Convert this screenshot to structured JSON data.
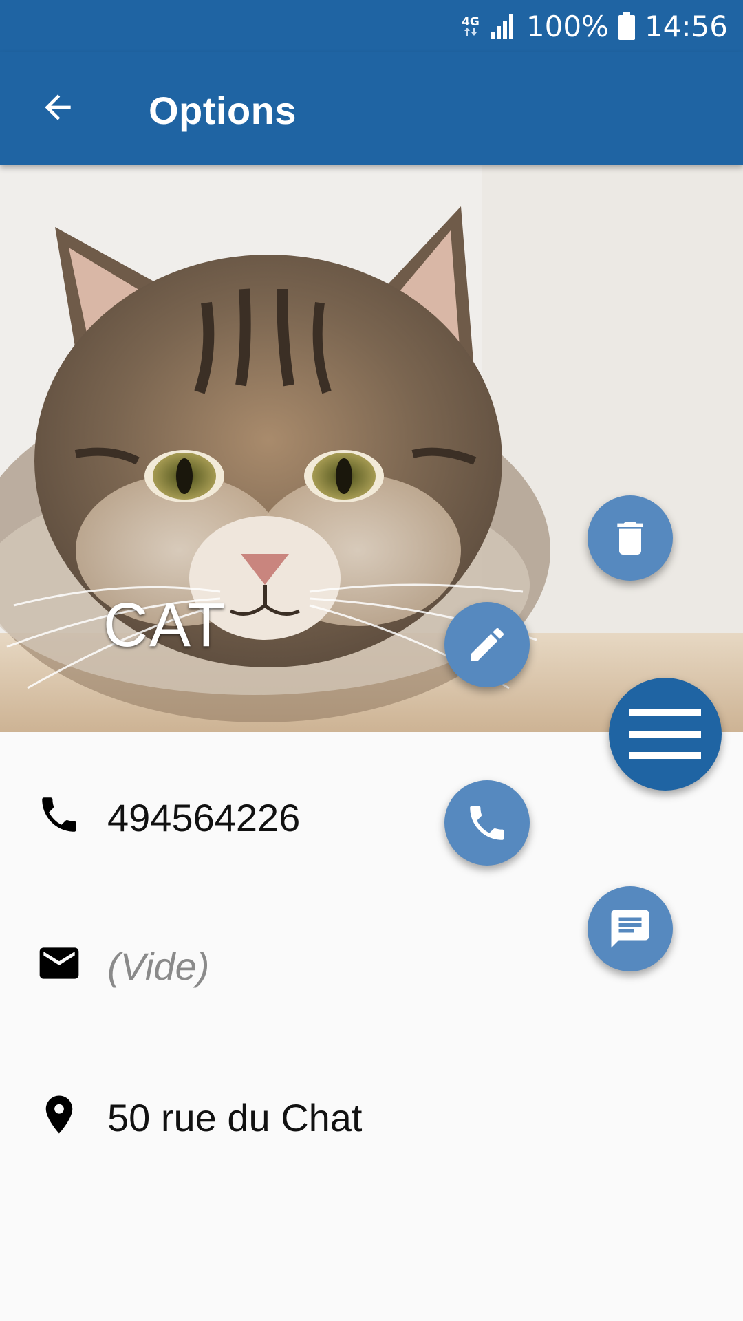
{
  "status_bar": {
    "network": "4G",
    "battery": "100%",
    "time": "14:56"
  },
  "app_bar": {
    "title": "Options"
  },
  "contact": {
    "name": "CAT",
    "phone": "494564226",
    "email": "(Vide)",
    "address": "50 rue du Chat"
  },
  "fabs": [
    "delete-icon",
    "edit-icon",
    "menu-icon",
    "call-icon",
    "message-icon"
  ],
  "colors": {
    "primary": "#1f64a3",
    "fab_mini": "#5689bf",
    "background": "#fafafa"
  }
}
